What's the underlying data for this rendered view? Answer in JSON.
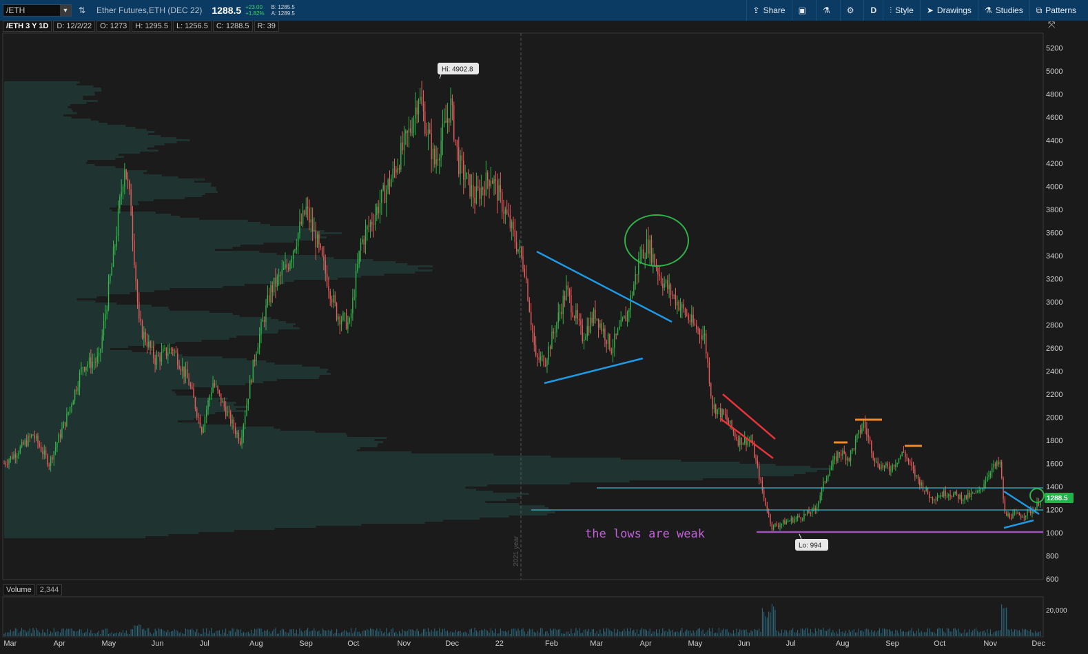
{
  "toolbar": {
    "symbol": "/ETH",
    "description": "Ether Futures,ETH (DEC 22)",
    "last": "1288.5",
    "change": "+23.00",
    "change_pct": "+1.82%",
    "bid": "B: 1285.5",
    "ask": "A: 1289.5",
    "share_label": "Share",
    "aggregation": "D",
    "style_label": "Style",
    "drawings_label": "Drawings",
    "studies_label": "Studies",
    "patterns_label": "Patterns"
  },
  "info": {
    "symbol_period": "/ETH 3 Y 1D",
    "date": "D: 12/2/22",
    "open": "O: 1273",
    "high": "H: 1295.5",
    "low": "L: 1256.5",
    "close": "C: 1288.5",
    "range": "R: 39"
  },
  "volume_panel": {
    "label": "Volume",
    "value": "2,344",
    "axis_tick": "20,000"
  },
  "colors": {
    "up": "#31b64a",
    "down": "#e85c5c",
    "blue_line": "#1e9be6",
    "red_channel": "#e8333b",
    "cyan_line": "#39b8d0",
    "magenta_line": "#a24fc0",
    "orange": "#f08a2a",
    "circle": "#2fb24a"
  },
  "chart_data": {
    "type": "candlestick",
    "ylim": [
      600,
      5300
    ],
    "y_ticks": [
      600,
      800,
      1000,
      1200,
      1400,
      1600,
      1800,
      2000,
      2200,
      2400,
      2600,
      2800,
      3000,
      3200,
      3400,
      3600,
      3800,
      4000,
      4200,
      4400,
      4600,
      4800,
      5000,
      5200
    ],
    "x_labels": [
      "Mar",
      "Apr",
      "May",
      "Jun",
      "Jul",
      "Aug",
      "Sep",
      "Oct",
      "Nov",
      "Dec",
      "22",
      "Feb",
      "Mar",
      "Apr",
      "May",
      "Jun",
      "Jul",
      "Aug",
      "Sep",
      "Oct",
      "Nov",
      "Dec"
    ],
    "year_marker": "2021 year",
    "hi_label": "Hi: 4902.8",
    "lo_label": "Lo: 994",
    "last_price_label": "1288.5",
    "annotation": "the lows are weak",
    "price_path": [
      [
        "2021-02-25",
        1600
      ],
      [
        "2021-03-05",
        1700
      ],
      [
        "2021-03-15",
        1850
      ],
      [
        "2021-03-25",
        1600
      ],
      [
        "2021-04-05",
        2000
      ],
      [
        "2021-04-15",
        2450
      ],
      [
        "2021-04-25",
        2500
      ],
      [
        "2021-05-05",
        3500
      ],
      [
        "2021-05-11",
        4200
      ],
      [
        "2021-05-15",
        3800
      ],
      [
        "2021-05-20",
        2800
      ],
      [
        "2021-05-30",
        2500
      ],
      [
        "2021-06-10",
        2600
      ],
      [
        "2021-06-20",
        2300
      ],
      [
        "2021-06-28",
        1900
      ],
      [
        "2021-07-05",
        2300
      ],
      [
        "2021-07-15",
        2000
      ],
      [
        "2021-07-22",
        1800
      ],
      [
        "2021-08-01",
        2600
      ],
      [
        "2021-08-10",
        3100
      ],
      [
        "2021-08-20",
        3300
      ],
      [
        "2021-09-01",
        3800
      ],
      [
        "2021-09-08",
        3500
      ],
      [
        "2021-09-20",
        2900
      ],
      [
        "2021-09-28",
        2800
      ],
      [
        "2021-10-05",
        3500
      ],
      [
        "2021-10-15",
        3800
      ],
      [
        "2021-10-25",
        4100
      ],
      [
        "2021-11-05",
        4500
      ],
      [
        "2021-11-10",
        4800
      ],
      [
        "2021-11-20",
        4200
      ],
      [
        "2021-11-30",
        4700
      ],
      [
        "2021-12-05",
        4200
      ],
      [
        "2021-12-15",
        3900
      ],
      [
        "2021-12-25",
        4100
      ],
      [
        "2022-01-05",
        3700
      ],
      [
        "2022-01-15",
        3300
      ],
      [
        "2022-01-22",
        2500
      ],
      [
        "2022-01-28",
        2500
      ],
      [
        "2022-02-10",
        3100
      ],
      [
        "2022-02-20",
        2700
      ],
      [
        "2022-02-28",
        2900
      ],
      [
        "2022-03-10",
        2600
      ],
      [
        "2022-03-20",
        2900
      ],
      [
        "2022-03-28",
        3400
      ],
      [
        "2022-04-02",
        3500
      ],
      [
        "2022-04-10",
        3200
      ],
      [
        "2022-04-20",
        3000
      ],
      [
        "2022-04-30",
        2800
      ],
      [
        "2022-05-07",
        2700
      ],
      [
        "2022-05-12",
        2100
      ],
      [
        "2022-05-20",
        2000
      ],
      [
        "2022-05-28",
        1800
      ],
      [
        "2022-06-05",
        1800
      ],
      [
        "2022-06-13",
        1300
      ],
      [
        "2022-06-18",
        1050
      ],
      [
        "2022-06-28",
        1100
      ],
      [
        "2022-07-08",
        1150
      ],
      [
        "2022-07-15",
        1200
      ],
      [
        "2022-07-22",
        1500
      ],
      [
        "2022-07-30",
        1700
      ],
      [
        "2022-08-05",
        1650
      ],
      [
        "2022-08-14",
        1950
      ],
      [
        "2022-08-22",
        1600
      ],
      [
        "2022-08-30",
        1550
      ],
      [
        "2022-09-08",
        1700
      ],
      [
        "2022-09-15",
        1500
      ],
      [
        "2022-09-25",
        1300
      ],
      [
        "2022-10-05",
        1350
      ],
      [
        "2022-10-15",
        1300
      ],
      [
        "2022-10-25",
        1350
      ],
      [
        "2022-11-01",
        1550
      ],
      [
        "2022-11-07",
        1600
      ],
      [
        "2022-11-10",
        1150
      ],
      [
        "2022-11-20",
        1150
      ],
      [
        "2022-11-28",
        1200
      ],
      [
        "2022-12-02",
        1288
      ]
    ]
  }
}
